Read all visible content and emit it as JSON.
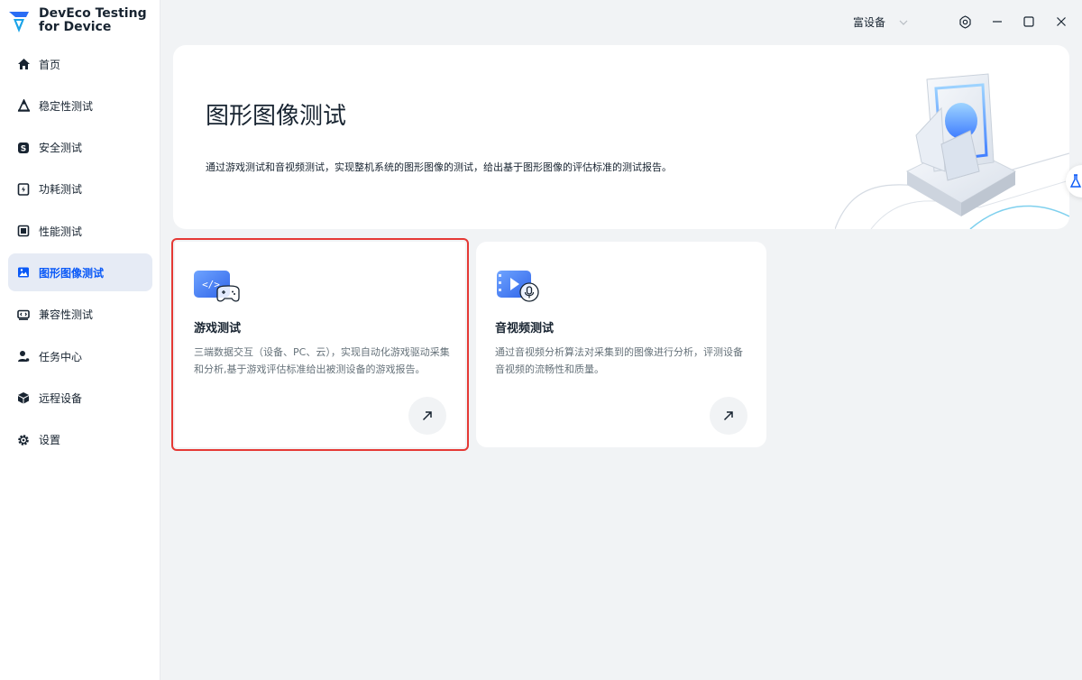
{
  "app": {
    "name": "DevEco Testing\nfor Device"
  },
  "sidebar": {
    "items": [
      {
        "label": "首页",
        "icon": "home-icon",
        "active": false
      },
      {
        "label": "稳定性测试",
        "icon": "stability-icon",
        "active": false
      },
      {
        "label": "安全测试",
        "icon": "shield-icon",
        "active": false
      },
      {
        "label": "功耗测试",
        "icon": "power-icon",
        "active": false
      },
      {
        "label": "性能测试",
        "icon": "performance-icon",
        "active": false
      },
      {
        "label": "图形图像测试",
        "icon": "image-icon",
        "active": true
      },
      {
        "label": "兼容性测试",
        "icon": "compatibility-icon",
        "active": false
      },
      {
        "label": "任务中心",
        "icon": "task-icon",
        "active": false
      },
      {
        "label": "远程设备",
        "icon": "cube-icon",
        "active": false
      },
      {
        "label": "设置",
        "icon": "gear-icon",
        "active": false
      }
    ]
  },
  "titlebar": {
    "device_label": "富设备"
  },
  "banner": {
    "title": "图形图像测试",
    "description": "通过游戏测试和音视频测试，实现整机系统的图形图像的测试，给出基于图形图像的评估标准的测试报告。"
  },
  "cards": [
    {
      "title": "游戏测试",
      "description": "三端数据交互（设备、PC、云），实现自动化游戏驱动采集和分析,基于游戏评估标准给出被测设备的游戏报告。",
      "icon": "game-test-icon",
      "selected": true
    },
    {
      "title": "音视频测试",
      "description": "通过音视频分析算法对采集到的图像进行分析，评测设备音视频的流畅性和质量。",
      "icon": "av-test-icon",
      "selected": false
    }
  ],
  "colors": {
    "accent": "#0a59f7",
    "active_bg": "#e6ebf5",
    "selection_outline": "#e53935",
    "page_bg": "#f1f3f5"
  }
}
